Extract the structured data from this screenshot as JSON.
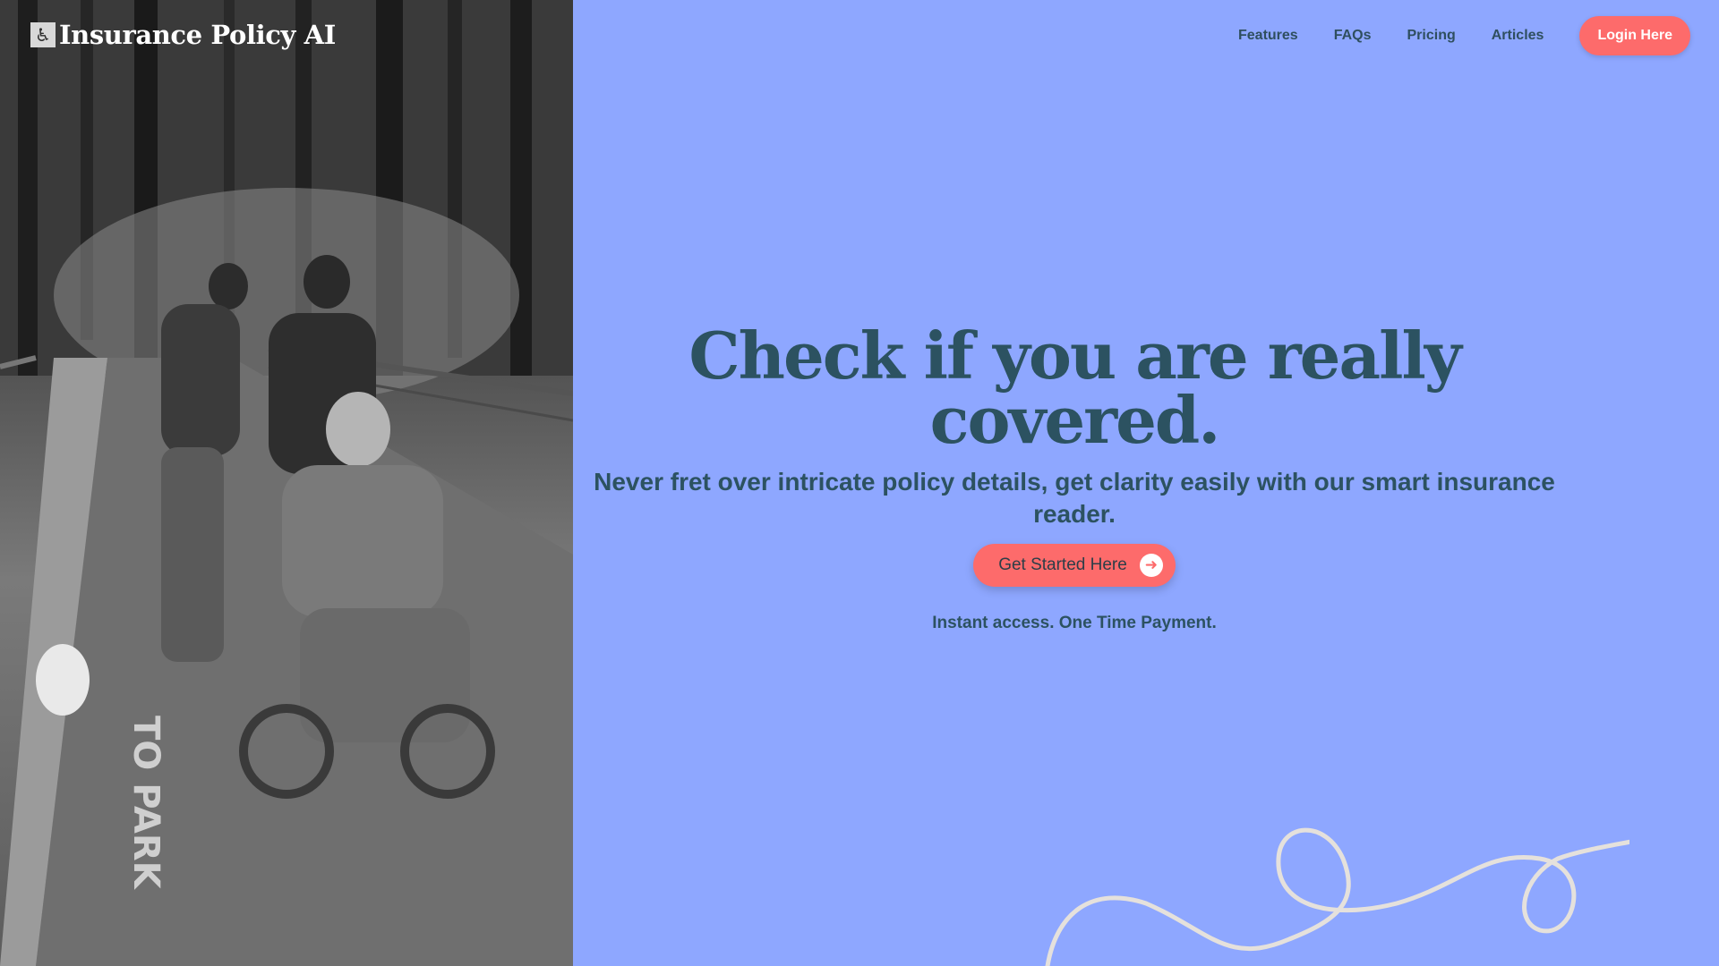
{
  "brand": {
    "icon": "wheelchair-icon",
    "icon_glyph": "♿",
    "name": "Insurance Policy AI"
  },
  "nav": {
    "links": [
      "Features",
      "FAQs",
      "Pricing",
      "Articles"
    ],
    "login_label": "Login Here"
  },
  "hero": {
    "headline": "Check if you are really covered.",
    "subheadline": "Never fret over intricate policy details, get clarity easily with our smart insurance reader.",
    "cta_label": "Get Started Here",
    "cta_icon": "arrow-right-icon",
    "cta_icon_glyph": "➜",
    "note": "Instant access. One Time Payment."
  },
  "colors": {
    "background": "#8ea7ff",
    "accent": "#fd6b6b",
    "text": "#2c5261",
    "squiggle": "#e5e1dc"
  }
}
